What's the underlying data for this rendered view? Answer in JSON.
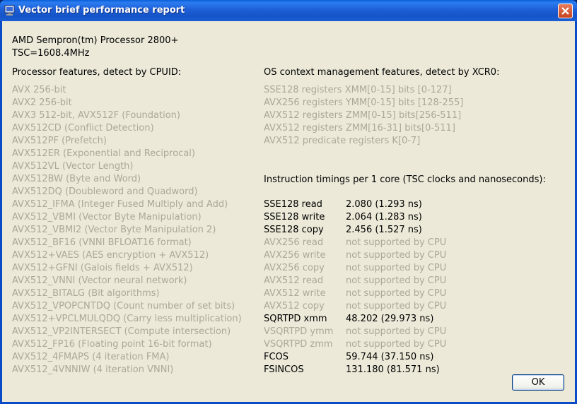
{
  "window": {
    "title": "Vector brief performance report"
  },
  "cpu": {
    "name": "AMD Sempron(tm) Processor 2800+",
    "tsc": "TSC=1608.4MHz"
  },
  "features": {
    "header": "Processor features, detect by CPUID:",
    "items": [
      "AVX 256-bit",
      "AVX2 256-bit",
      "AVX3 512-bit, AVX512F (Foundation)",
      "AVX512CD (Conflict Detection)",
      "AVX512PF (Prefetch)",
      "AVX512ER (Exponential and Reciprocal)",
      "AVX512VL (Vector Length)",
      "AVX512BW (Byte and Word)",
      "AVX512DQ (Doubleword and Quadword)",
      "AVX512_IFMA (Integer Fused Multiply and Add)",
      "AVX512_VBMI (Vector Byte Manipulation)",
      "AVX512_VBMI2 (Vector Byte Manipulation 2)",
      "AVX512_BF16 (VNNI BFLOAT16 format)",
      "AVX512+VAES (AES encryption + AVX512)",
      "AVX512+GFNI (Galois fields + AVX512)",
      "AVX512_VNNI (Vector neural network)",
      "AVX512_BITALG (Bit algorithms)",
      "AVX512_VPOPCNTDQ (Count number of set bits)",
      "AVX512+VPCLMULQDQ (Carry less multiplication)",
      "AVX512_VP2INTERSECT (Compute intersection)",
      "AVX512_FP16 (Floating point 16-bit format)",
      "AVX512_4FMAPS (4 iteration FMA)",
      "AVX512_4VNNIW (4 iteration VNNI)"
    ]
  },
  "os_features": {
    "header": "OS context management features, detect by XCR0:",
    "items": [
      "SSE128 registers XMM[0-15] bits [0-127]",
      "AVX256 registers YMM[0-15] bits [128-255]",
      "AVX512 registers ZMM[0-15] bits[256-511]",
      "AVX512 registers ZMM[16-31] bits[0-511]",
      "AVX512 predicate registers K[0-7]"
    ]
  },
  "timings": {
    "header": "Instruction timings per 1 core (TSC clocks and nanoseconds):",
    "rows": [
      {
        "name": "SSE128 read",
        "value": "2.080 (1.293 ns)",
        "supported": true
      },
      {
        "name": "SSE128 write",
        "value": "2.064 (1.283 ns)",
        "supported": true
      },
      {
        "name": "SSE128 copy",
        "value": "2.456 (1.527 ns)",
        "supported": true
      },
      {
        "name": "AVX256 read",
        "value": "not supported by CPU",
        "supported": false
      },
      {
        "name": "AVX256 write",
        "value": "not supported by CPU",
        "supported": false
      },
      {
        "name": "AVX256 copy",
        "value": "not supported by CPU",
        "supported": false
      },
      {
        "name": "AVX512 read",
        "value": "not supported by CPU",
        "supported": false
      },
      {
        "name": "AVX512 write",
        "value": "not supported by CPU",
        "supported": false
      },
      {
        "name": "AVX512 copy",
        "value": "not supported by CPU",
        "supported": false
      },
      {
        "name": "SQRTPD xmm",
        "value": "48.202 (29.973 ns)",
        "supported": true
      },
      {
        "name": "VSQRTPD ymm",
        "value": "not supported by CPU",
        "supported": false
      },
      {
        "name": "VSQRTPD zmm",
        "value": "not supported by CPU",
        "supported": false
      },
      {
        "name": "FCOS",
        "value": "59.744 (37.150 ns)",
        "supported": true
      },
      {
        "name": "FSINCOS",
        "value": "131.180 (81.571 ns)",
        "supported": true
      }
    ]
  },
  "buttons": {
    "ok": "OK"
  }
}
